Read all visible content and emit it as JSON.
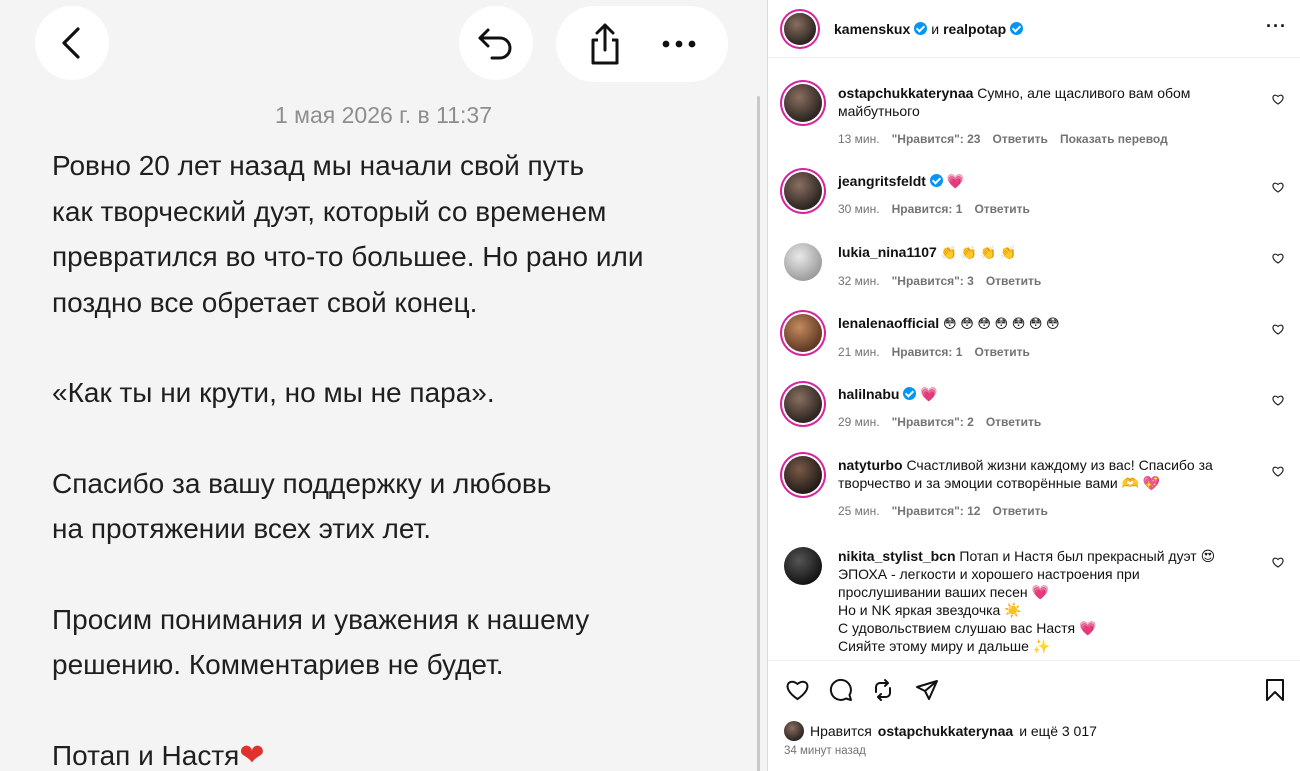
{
  "note": {
    "date": "1 мая 2026 г. в 11:37",
    "paragraphs": [
      "Ровно 20 лет назад мы начали свой путь\nкак творческий дуэт, который со временем\nпревратился во что-то большее. Но рано или\nпоздно все обретает свой конец.",
      "«Как ты ни крути, но мы не пара».",
      "Спасибо за вашу поддержку и любовь\nна протяжении всех этих лет.",
      "Просим понимания и уважения к нашему\nрешению. Комментариев не будет."
    ],
    "signature": "Потап и Настя",
    "signature_emoji": "❤"
  },
  "post": {
    "author1": "kamenskux",
    "and": "и",
    "author2": "realpotap",
    "more": "···"
  },
  "comments": [
    {
      "user": "ostapchukkaterynaa",
      "text": "Сумно, але щасливого вам обом\nмайбутнього",
      "time": "13 мин.",
      "likes": "\"Нравится\": 23",
      "reply": "Ответить",
      "extra": "Показать перевод"
    },
    {
      "user": "jeangritsfeldt",
      "verified": true,
      "text": "💗",
      "time": "30 мин.",
      "likes": "Нравится: 1",
      "reply": "Ответить",
      "extra": ""
    },
    {
      "user": "lukia_nina1107",
      "text": "👏 👏 👏 👏",
      "time": "32 мин.",
      "likes": "\"Нравится\": 3",
      "reply": "Ответить",
      "extra": ""
    },
    {
      "user": "lenalenaofficial",
      "text": "😳 😳 😳 😳 😳 😳 😳",
      "time": "21 мин.",
      "likes": "Нравится: 1",
      "reply": "Ответить",
      "extra": ""
    },
    {
      "user": "halilnabu",
      "verified": true,
      "text": "💗",
      "time": "29 мин.",
      "likes": "\"Нравится\": 2",
      "reply": "Ответить",
      "extra": ""
    },
    {
      "user": "natyturbo",
      "text": "Счастливой жизни каждому из вас! Спасибо за\nтворчество и за эмоции сотворённые вами 🫶 💖",
      "time": "25 мин.",
      "likes": "\"Нравится\": 12",
      "reply": "Ответить",
      "extra": ""
    },
    {
      "user": "nikita_stylist_bcn",
      "text": "Потап и Настя был прекрасный дуэт 😍\nЭПОХА - легкости и хорошего настроения при\nпрослушивании ваших песен 💗\nНо и NK яркая звездочка ☀️\nС удовольствием слушаю вас Настя 💗\nСияйте этому миру и дальше ✨",
      "time": "",
      "likes": "",
      "reply": "",
      "extra": ""
    }
  ],
  "footer": {
    "liked_prefix": "Нравится",
    "liked_user": "ostapchukkaterynaa",
    "liked_suffix": "и ещё 3 017",
    "ago": "34 минут назад"
  },
  "colors": {
    "accent": "#0095f6",
    "heart": "#ed1d50",
    "story_ring": "#d6249f"
  }
}
